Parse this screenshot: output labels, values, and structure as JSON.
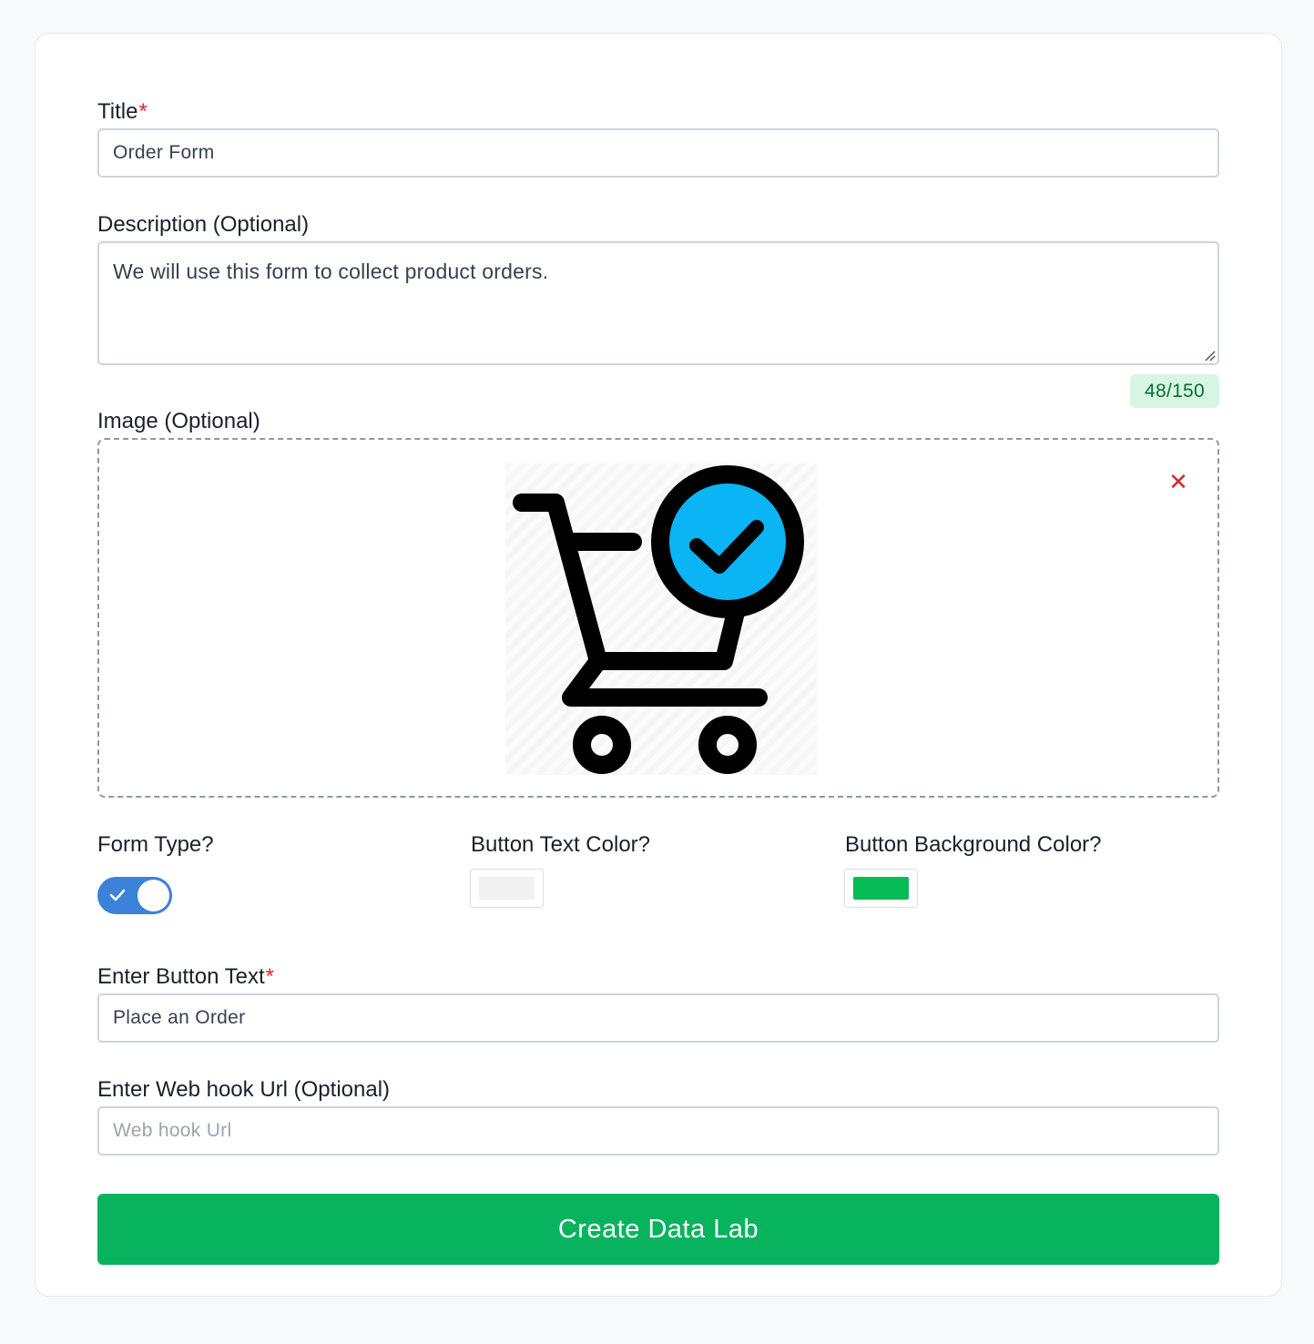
{
  "form": {
    "title": {
      "label": "Title",
      "required_mark": "*",
      "value": "Order Form"
    },
    "description": {
      "label": "Description (Optional)",
      "value": "We will use this form to collect product orders.",
      "counter": "48/150"
    },
    "image": {
      "label": "Image (Optional)",
      "remove_icon": "close-icon",
      "preview_icon": "shopping-cart-check-icon",
      "preview_accent_color": "#0bb4f5"
    },
    "form_type": {
      "label": "Form Type?",
      "toggle_on": true,
      "toggle_color": "#3b82d8"
    },
    "button_text_color": {
      "label": "Button Text Color?",
      "color": "#f1f1f1"
    },
    "button_background_color": {
      "label": "Button Background Color?",
      "color": "#07bb55"
    },
    "button_text": {
      "label": "Enter Button Text",
      "required_mark": "*",
      "value": "Place an Order"
    },
    "webhook": {
      "label": "Enter Web hook Url (Optional)",
      "placeholder": "Web hook Url",
      "value": ""
    },
    "submit": {
      "label": "Create Data Lab",
      "color": "#08b35e"
    }
  }
}
